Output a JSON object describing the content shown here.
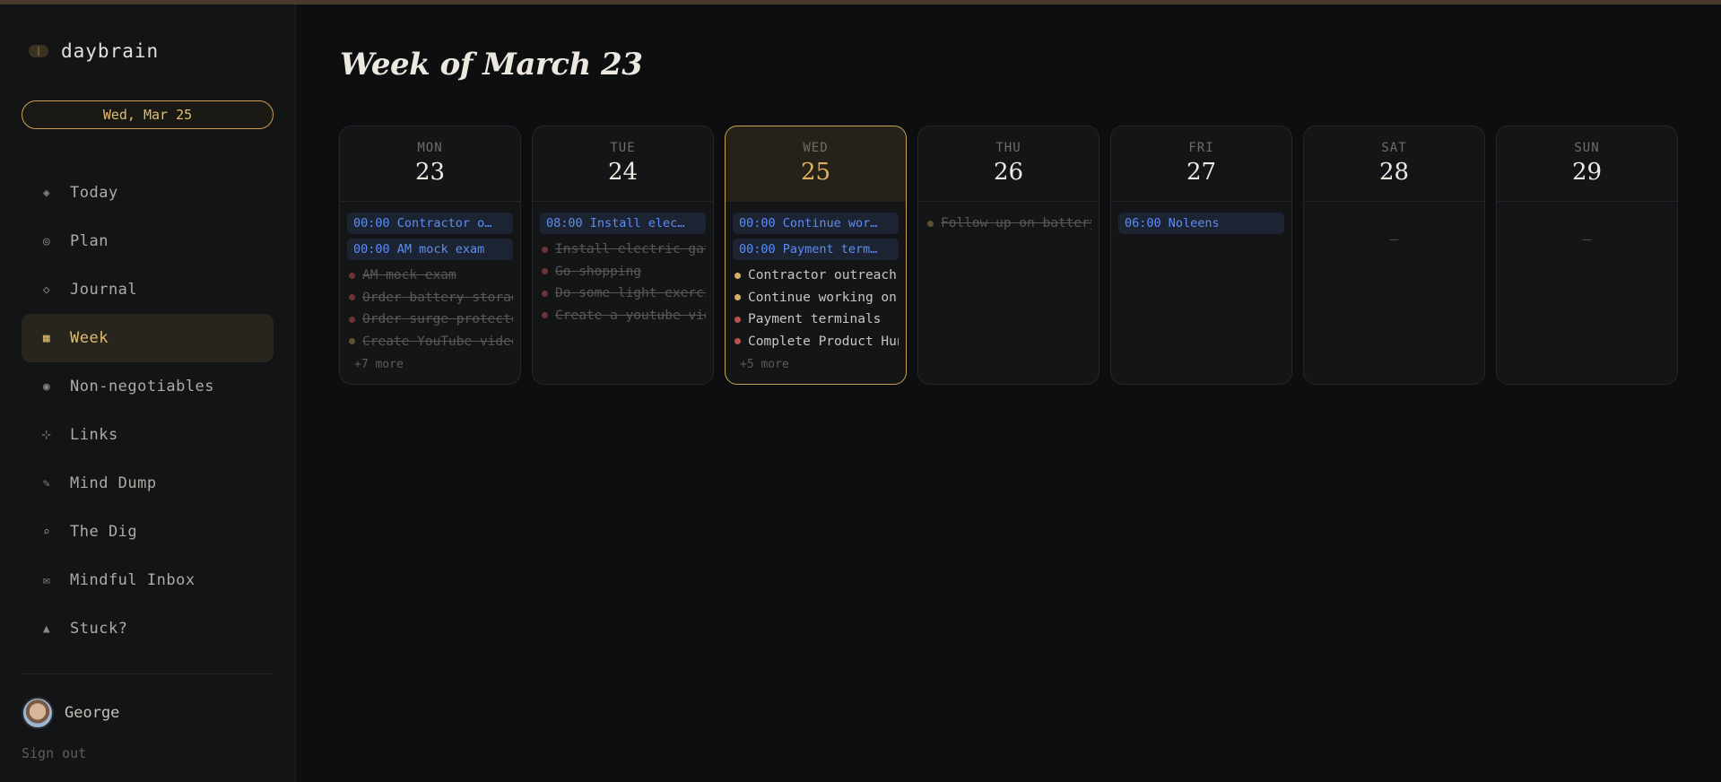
{
  "app": {
    "name": "daybrain"
  },
  "sidebar": {
    "date_pill": "Wed, Mar 25",
    "items": [
      {
        "label": "Today",
        "icon": "diamond-dot-icon",
        "glyph": "◈",
        "active": false
      },
      {
        "label": "Plan",
        "icon": "target-icon",
        "glyph": "◎",
        "active": false
      },
      {
        "label": "Journal",
        "icon": "diamond-outline-icon",
        "glyph": "◇",
        "active": false
      },
      {
        "label": "Week",
        "icon": "grid-icon",
        "glyph": "▦",
        "active": true
      },
      {
        "label": "Non-negotiables",
        "icon": "bullseye-icon",
        "glyph": "◉",
        "active": false
      },
      {
        "label": "Links",
        "icon": "sparkle-icon",
        "glyph": "⊹",
        "active": false
      },
      {
        "label": "Mind Dump",
        "icon": "pencil-icon",
        "glyph": "✎",
        "active": false
      },
      {
        "label": "The Dig",
        "icon": "search-icon",
        "glyph": "⌕",
        "active": false
      },
      {
        "label": "Mindful Inbox",
        "icon": "mail-icon",
        "glyph": "✉",
        "active": false
      },
      {
        "label": "Stuck?",
        "icon": "triangle-icon",
        "glyph": "▲",
        "active": false
      }
    ],
    "user": {
      "name": "George"
    },
    "sign_out": "Sign out"
  },
  "main": {
    "title": "Week of March 23"
  },
  "colors": {
    "accent": "#c9a257",
    "event_text": "#5c8df5",
    "dot_red": "#c0504f",
    "dot_red_dim": "#6e3433",
    "dot_yellow": "#d6b15e",
    "dot_yellow_dim": "#5e5030"
  },
  "week": [
    {
      "dow": "MON",
      "num": "23",
      "today": false,
      "events": [
        "00:00 Contractor o…",
        "00:00 AM mock exam"
      ],
      "tasks": [
        {
          "text": "AM mock exam",
          "done": true,
          "dot": "red"
        },
        {
          "text": "Order battery storage",
          "done": true,
          "dot": "red"
        },
        {
          "text": "Order surge protector",
          "done": true,
          "dot": "red"
        },
        {
          "text": "Create YouTube video",
          "done": true,
          "dot": "yellow"
        }
      ],
      "more": "+7 more"
    },
    {
      "dow": "TUE",
      "num": "24",
      "today": false,
      "events": [
        "08:00 Install elec…"
      ],
      "tasks": [
        {
          "text": "Install electric gate",
          "done": true,
          "dot": "red"
        },
        {
          "text": "Go shopping",
          "done": true,
          "dot": "red"
        },
        {
          "text": "Do some light exercise",
          "done": true,
          "dot": "red"
        },
        {
          "text": "Create a youtube video",
          "done": true,
          "dot": "red"
        }
      ],
      "more": ""
    },
    {
      "dow": "WED",
      "num": "25",
      "today": true,
      "events": [
        "00:00 Continue wor…",
        "00:00 Payment term…"
      ],
      "tasks": [
        {
          "text": "Contractor outreach",
          "done": false,
          "dot": "yellow"
        },
        {
          "text": "Continue working on",
          "done": false,
          "dot": "yellow"
        },
        {
          "text": "Payment terminals",
          "done": false,
          "dot": "red"
        },
        {
          "text": "Complete Product Hunt",
          "done": false,
          "dot": "red"
        }
      ],
      "more": "+5 more"
    },
    {
      "dow": "THU",
      "num": "26",
      "today": false,
      "events": [],
      "tasks": [
        {
          "text": "Follow up on battery",
          "done": true,
          "dot": "yellow"
        }
      ],
      "more": ""
    },
    {
      "dow": "FRI",
      "num": "27",
      "today": false,
      "events": [
        "06:00 Noleens"
      ],
      "tasks": [],
      "more": ""
    },
    {
      "dow": "SAT",
      "num": "28",
      "today": false,
      "events": [],
      "tasks": [],
      "more": "",
      "empty": "—"
    },
    {
      "dow": "SUN",
      "num": "29",
      "today": false,
      "events": [],
      "tasks": [],
      "more": "",
      "empty": "—"
    }
  ]
}
